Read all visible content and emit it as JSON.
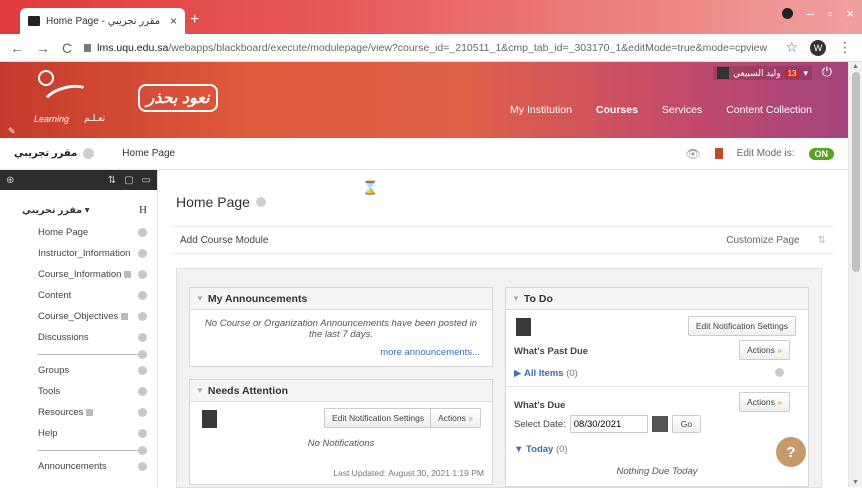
{
  "browser": {
    "tab_title": "Home Page - مقرر تجريبي",
    "tab_close": "×",
    "new_tab": "+",
    "url_host": "lms.uqu.edu.sa",
    "url_path": "/webapps/blackboard/execute/modulepage/view?course_id=_210511_1&cmp_tab_id=_303170_1&editMode=true&mode=cpview",
    "profile_initial": "W",
    "back": "←",
    "forward": "→",
    "reload": "C",
    "star": "☆",
    "menu": "⋮",
    "minimize": "–",
    "maximize": "▫",
    "close": "×"
  },
  "header": {
    "logo_learning": "Learning",
    "logo_arabic": "تعـلـم",
    "banner_text": "نعود بحذر",
    "edit_pen": "✎",
    "nav": [
      {
        "label": "My Institution",
        "active": false
      },
      {
        "label": "Courses",
        "active": true
      },
      {
        "label": "Services",
        "active": false
      },
      {
        "label": "Content Collection",
        "active": false
      }
    ],
    "user_name": "وليد السبيعي",
    "notification_count": "13",
    "user_menu_arrow": "▾",
    "power_icon": "⏻"
  },
  "breadcrumb": {
    "course": "مقرر تجريبي",
    "page": "Home Page",
    "edit_mode_label": "Edit Mode is:",
    "edit_mode_value": "ON"
  },
  "menu": {
    "tools": [
      "⊕",
      "⇅",
      "▢",
      "▭"
    ],
    "course_title": "مقرر تجريبي",
    "h_marker": "H",
    "items": [
      {
        "label": "Home Page",
        "ext": false
      },
      {
        "label": "Instructor_Information",
        "ext": false
      },
      {
        "label": "Course_Information",
        "ext": true
      },
      {
        "label": "Content",
        "ext": false
      },
      {
        "label": "Course_Objectives",
        "ext": true
      },
      {
        "label": "Discussions",
        "ext": false
      },
      {
        "label": "Groups",
        "ext": false
      },
      {
        "label": "Tools",
        "ext": false
      },
      {
        "label": "Resources",
        "ext": true
      },
      {
        "label": "Help",
        "ext": false
      },
      {
        "label": "Announcements",
        "ext": false
      }
    ]
  },
  "content": {
    "page_title": "Home Page",
    "add_course_module": "Add Course Module",
    "customize_page": "Customize Page",
    "customize_arrows": "⇅",
    "hourglass": "⌛"
  },
  "announcements": {
    "title": "My Announcements",
    "empty_text": "No Course or Organization Announcements have been posted in the last 7 days.",
    "more_link": "more announcements..."
  },
  "needs_attention": {
    "title": "Needs Attention",
    "edit_settings": "Edit Notification Settings",
    "actions": "Actions",
    "empty_text": "No Notifications",
    "last_updated": "Last Updated: August 30, 2021 1:19 PM"
  },
  "todo": {
    "title": "To Do",
    "edit_settings": "Edit Notification Settings",
    "past_due_label": "What's Past Due",
    "actions": "Actions",
    "all_items": "All Items",
    "all_items_count": "(0)",
    "due_label": "What's Due",
    "select_date_label": "Select Date:",
    "date_value": "08/30/2021",
    "go": "Go",
    "today": "Today",
    "today_count": "(0)",
    "nothing_due": "Nothing Due Today"
  },
  "help_button": "?"
}
